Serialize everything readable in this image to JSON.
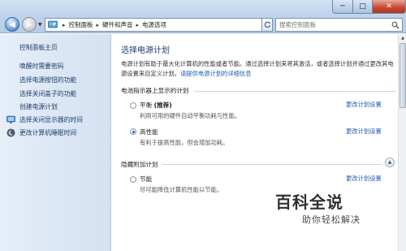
{
  "address": {
    "breadcrumbs": [
      "控制面板",
      "硬件和声音",
      "电源选项"
    ]
  },
  "search": {
    "placeholder": "搜索控制面板"
  },
  "window_controls": {
    "minimize": "─",
    "maximize": "□",
    "close": "✕"
  },
  "sidebar": {
    "home": "控制面板主页",
    "items": [
      {
        "label": "唤醒时需要密码",
        "icon": ""
      },
      {
        "label": "选择电源按钮的功能",
        "icon": ""
      },
      {
        "label": "选择关闭盖子的功能",
        "icon": ""
      },
      {
        "label": "创建电源计划",
        "icon": ""
      },
      {
        "label": "选择关闭显示器的时间",
        "icon": "monitor-icon"
      },
      {
        "label": "更改计算机睡眠时间",
        "icon": "moon-icon"
      }
    ]
  },
  "main": {
    "title": "选择电源计划",
    "intro": "电源计划有助于最大化计算机的性能或者节能。通过选择计划来将其激活，或者选择计划并通过更改其电源设置来自定义计划。",
    "intro_link": "请提供电源计划的详细信息",
    "section1_label": "电池指示器上显示的计划",
    "section2_label": "隐藏附加计划",
    "plans": [
      {
        "name": "平衡",
        "tag": "(推荐)",
        "desc": "利用可用的硬件自动平衡功耗与性能。",
        "link": "更改计划设置",
        "selected": false
      },
      {
        "name": "高性能",
        "tag": "",
        "desc": "有利于提高性能，但会增加功耗。",
        "link": "更改计划设置",
        "selected": true
      },
      {
        "name": "节能",
        "tag": "",
        "desc": "尽可能降低计算机性能以节能。",
        "link": "更改计划设置",
        "selected": false
      }
    ]
  },
  "watermark": {
    "logo": "百科全说",
    "sub": "助你轻松解决"
  },
  "colors": {
    "link": "#1a5cb0",
    "title": "#1e3d6b",
    "close": "#c6452f"
  }
}
